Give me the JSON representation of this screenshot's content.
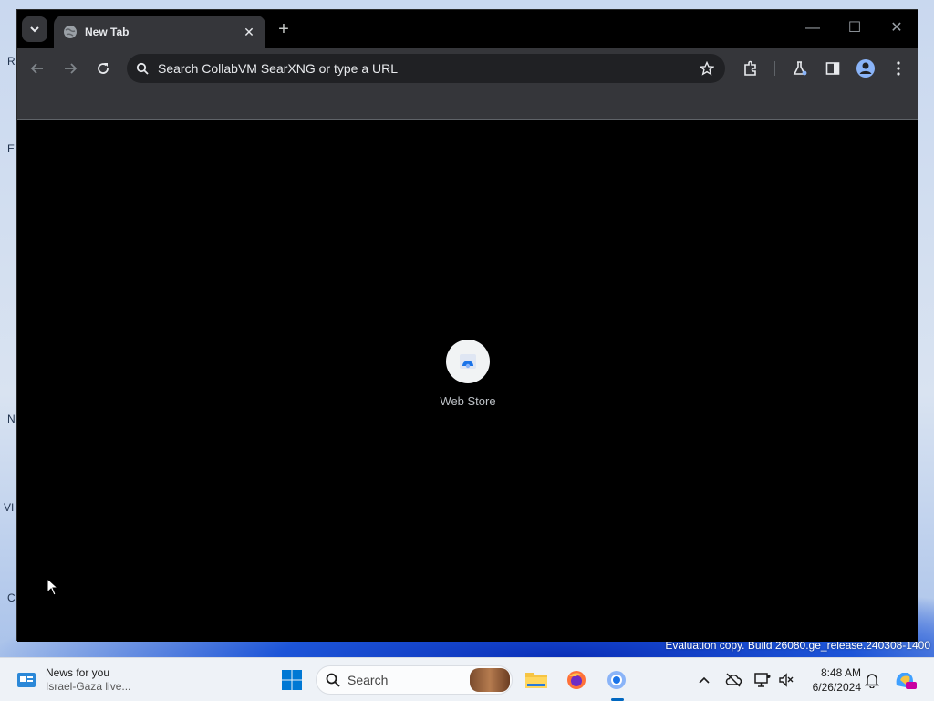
{
  "browser": {
    "tab_title": "New Tab",
    "tab_close": "✕",
    "new_tab": "+",
    "window_controls": {
      "minimize": "—",
      "maximize": "☐",
      "close": "✕"
    },
    "omnibox_placeholder": "Search CollabVM SearXNG or type a URL",
    "shortcut_label": "Web Store",
    "icons": [
      "tab-search-icon",
      "globe-icon",
      "back-icon",
      "forward-icon",
      "reload-icon",
      "search-icon",
      "star-icon",
      "extensions-icon",
      "labs-icon",
      "side-panel-icon",
      "profile-icon",
      "menu-icon",
      "web-store-icon"
    ]
  },
  "desktop": {
    "watermark": "Evaluation copy. Build 26080.ge_release.240308-1400",
    "partial_icon_letters": [
      "R",
      "E",
      "N",
      "VI",
      "C"
    ]
  },
  "taskbar": {
    "news_title": "News for you",
    "news_subtitle": "Israel-Gaza live...",
    "search_label": "Search",
    "time": "8:48 AM",
    "date": "6/26/2024",
    "accent": "#0067c0"
  }
}
